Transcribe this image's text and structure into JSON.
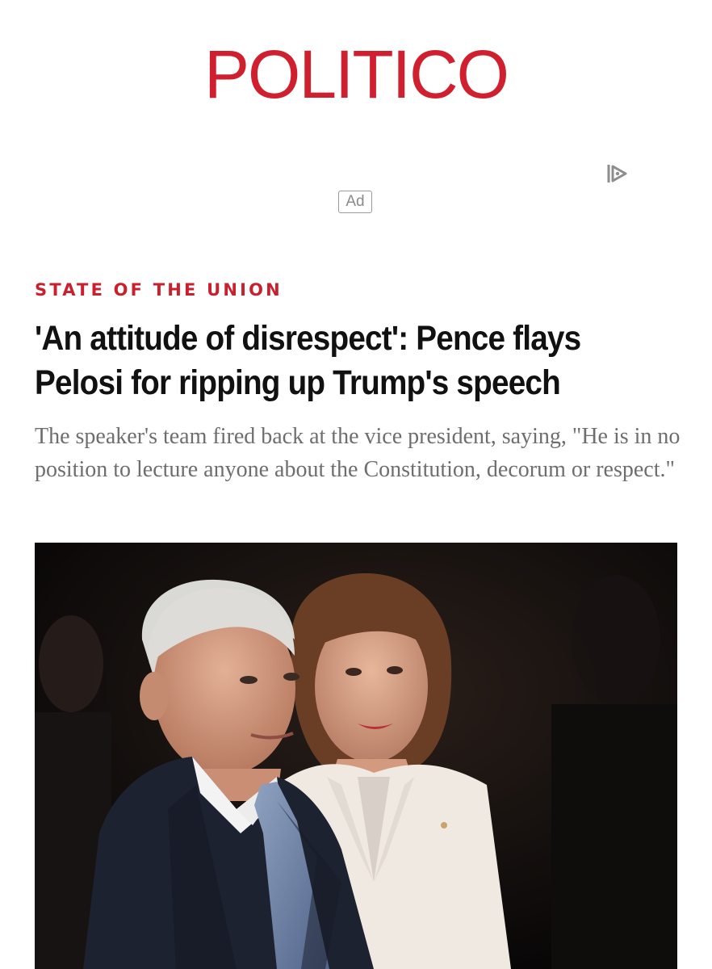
{
  "header": {
    "logo_text": "POLITICO"
  },
  "ad": {
    "badge_label": "Ad",
    "choices_icon": "adchoices-icon"
  },
  "article": {
    "kicker": "STATE OF THE UNION",
    "headline": "'An attitude of disrespect': Pence flays Pelosi for ripping up Trump's speech",
    "dek": "The speaker's team fired back at the vice president, saying, \"He is in no position to lecture anyone about the Constitution, decorum or respect.\"",
    "photo_subject": "Photo of Mike Pence and Nancy Pelosi"
  },
  "colors": {
    "brand_red": "#d0202f",
    "kicker_red": "#c8202c",
    "headline": "#111111",
    "dek_gray": "#6e6e6e"
  }
}
